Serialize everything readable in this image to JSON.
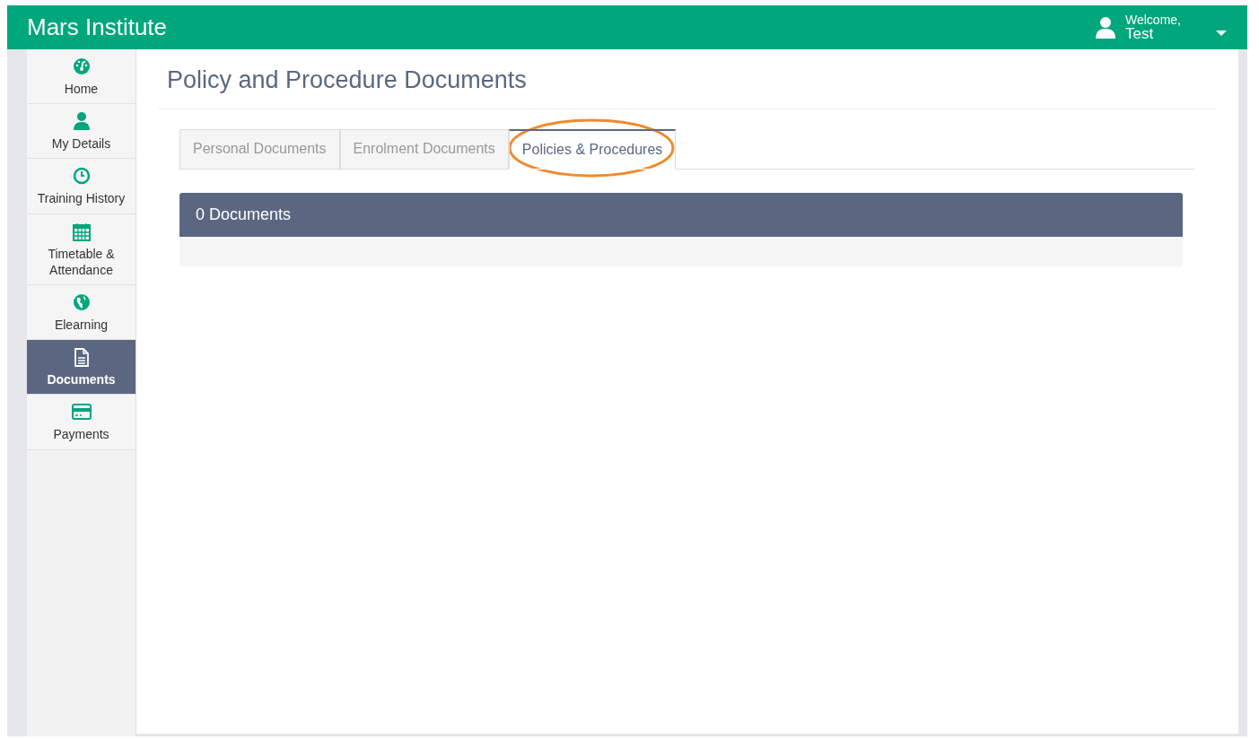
{
  "header": {
    "title": "Mars Institute",
    "welcome": "Welcome,",
    "user": "Test"
  },
  "sidebar": {
    "items": [
      {
        "label": "Home",
        "selected": false
      },
      {
        "label": "My Details",
        "selected": false
      },
      {
        "label": "Training History",
        "selected": false
      },
      {
        "label": "Timetable & Attendance",
        "selected": false
      },
      {
        "label": "Elearning",
        "selected": false
      },
      {
        "label": "Documents",
        "selected": true
      },
      {
        "label": "Payments",
        "selected": false
      }
    ]
  },
  "page": {
    "title": "Policy and Procedure Documents"
  },
  "tabs": [
    {
      "label": "Personal Documents",
      "selected": false
    },
    {
      "label": "Enrolment Documents",
      "selected": false
    },
    {
      "label": "Policies & Procedures",
      "selected": true,
      "highlighted": true
    }
  ],
  "panel": {
    "heading": "0 Documents"
  }
}
